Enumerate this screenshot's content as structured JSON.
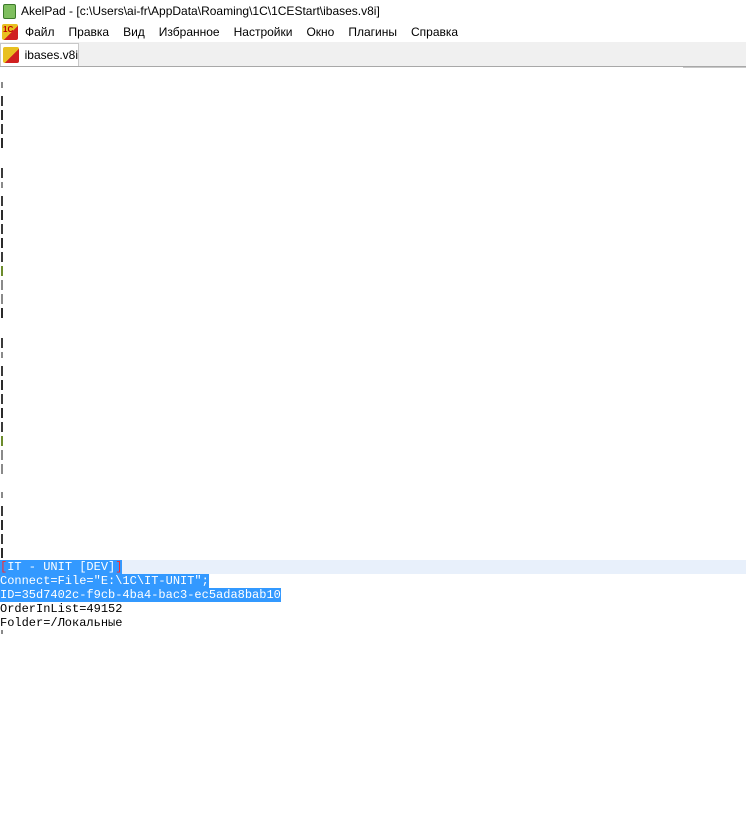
{
  "window": {
    "title": "AkelPad - [c:\\Users\\ai-fr\\AppData\\Roaming\\1C\\1CEStart\\ibases.v8i]"
  },
  "menu": {
    "items": [
      "Файл",
      "Правка",
      "Вид",
      "Избранное",
      "Настройки",
      "Окно",
      "Плагины",
      "Справка"
    ]
  },
  "tabs": [
    {
      "label": "ibases.v8i"
    }
  ],
  "editor": {
    "lines": {
      "header_open": "[",
      "header_text": "IT - UNIT [DEV]",
      "header_close": "]",
      "connect": "Connect=File=\"E:\\1C\\IT-UNIT\";",
      "id": "ID=35d7402c-f9cb-4ba4-bac3-ec5ada8bab10",
      "order": "OrderInList=49152",
      "folder": "Folder=/Локальные"
    }
  },
  "icons": {
    "app": "akelpad-icon",
    "menu_logo": "1c-logo-icon",
    "tab": "1c-file-icon"
  }
}
